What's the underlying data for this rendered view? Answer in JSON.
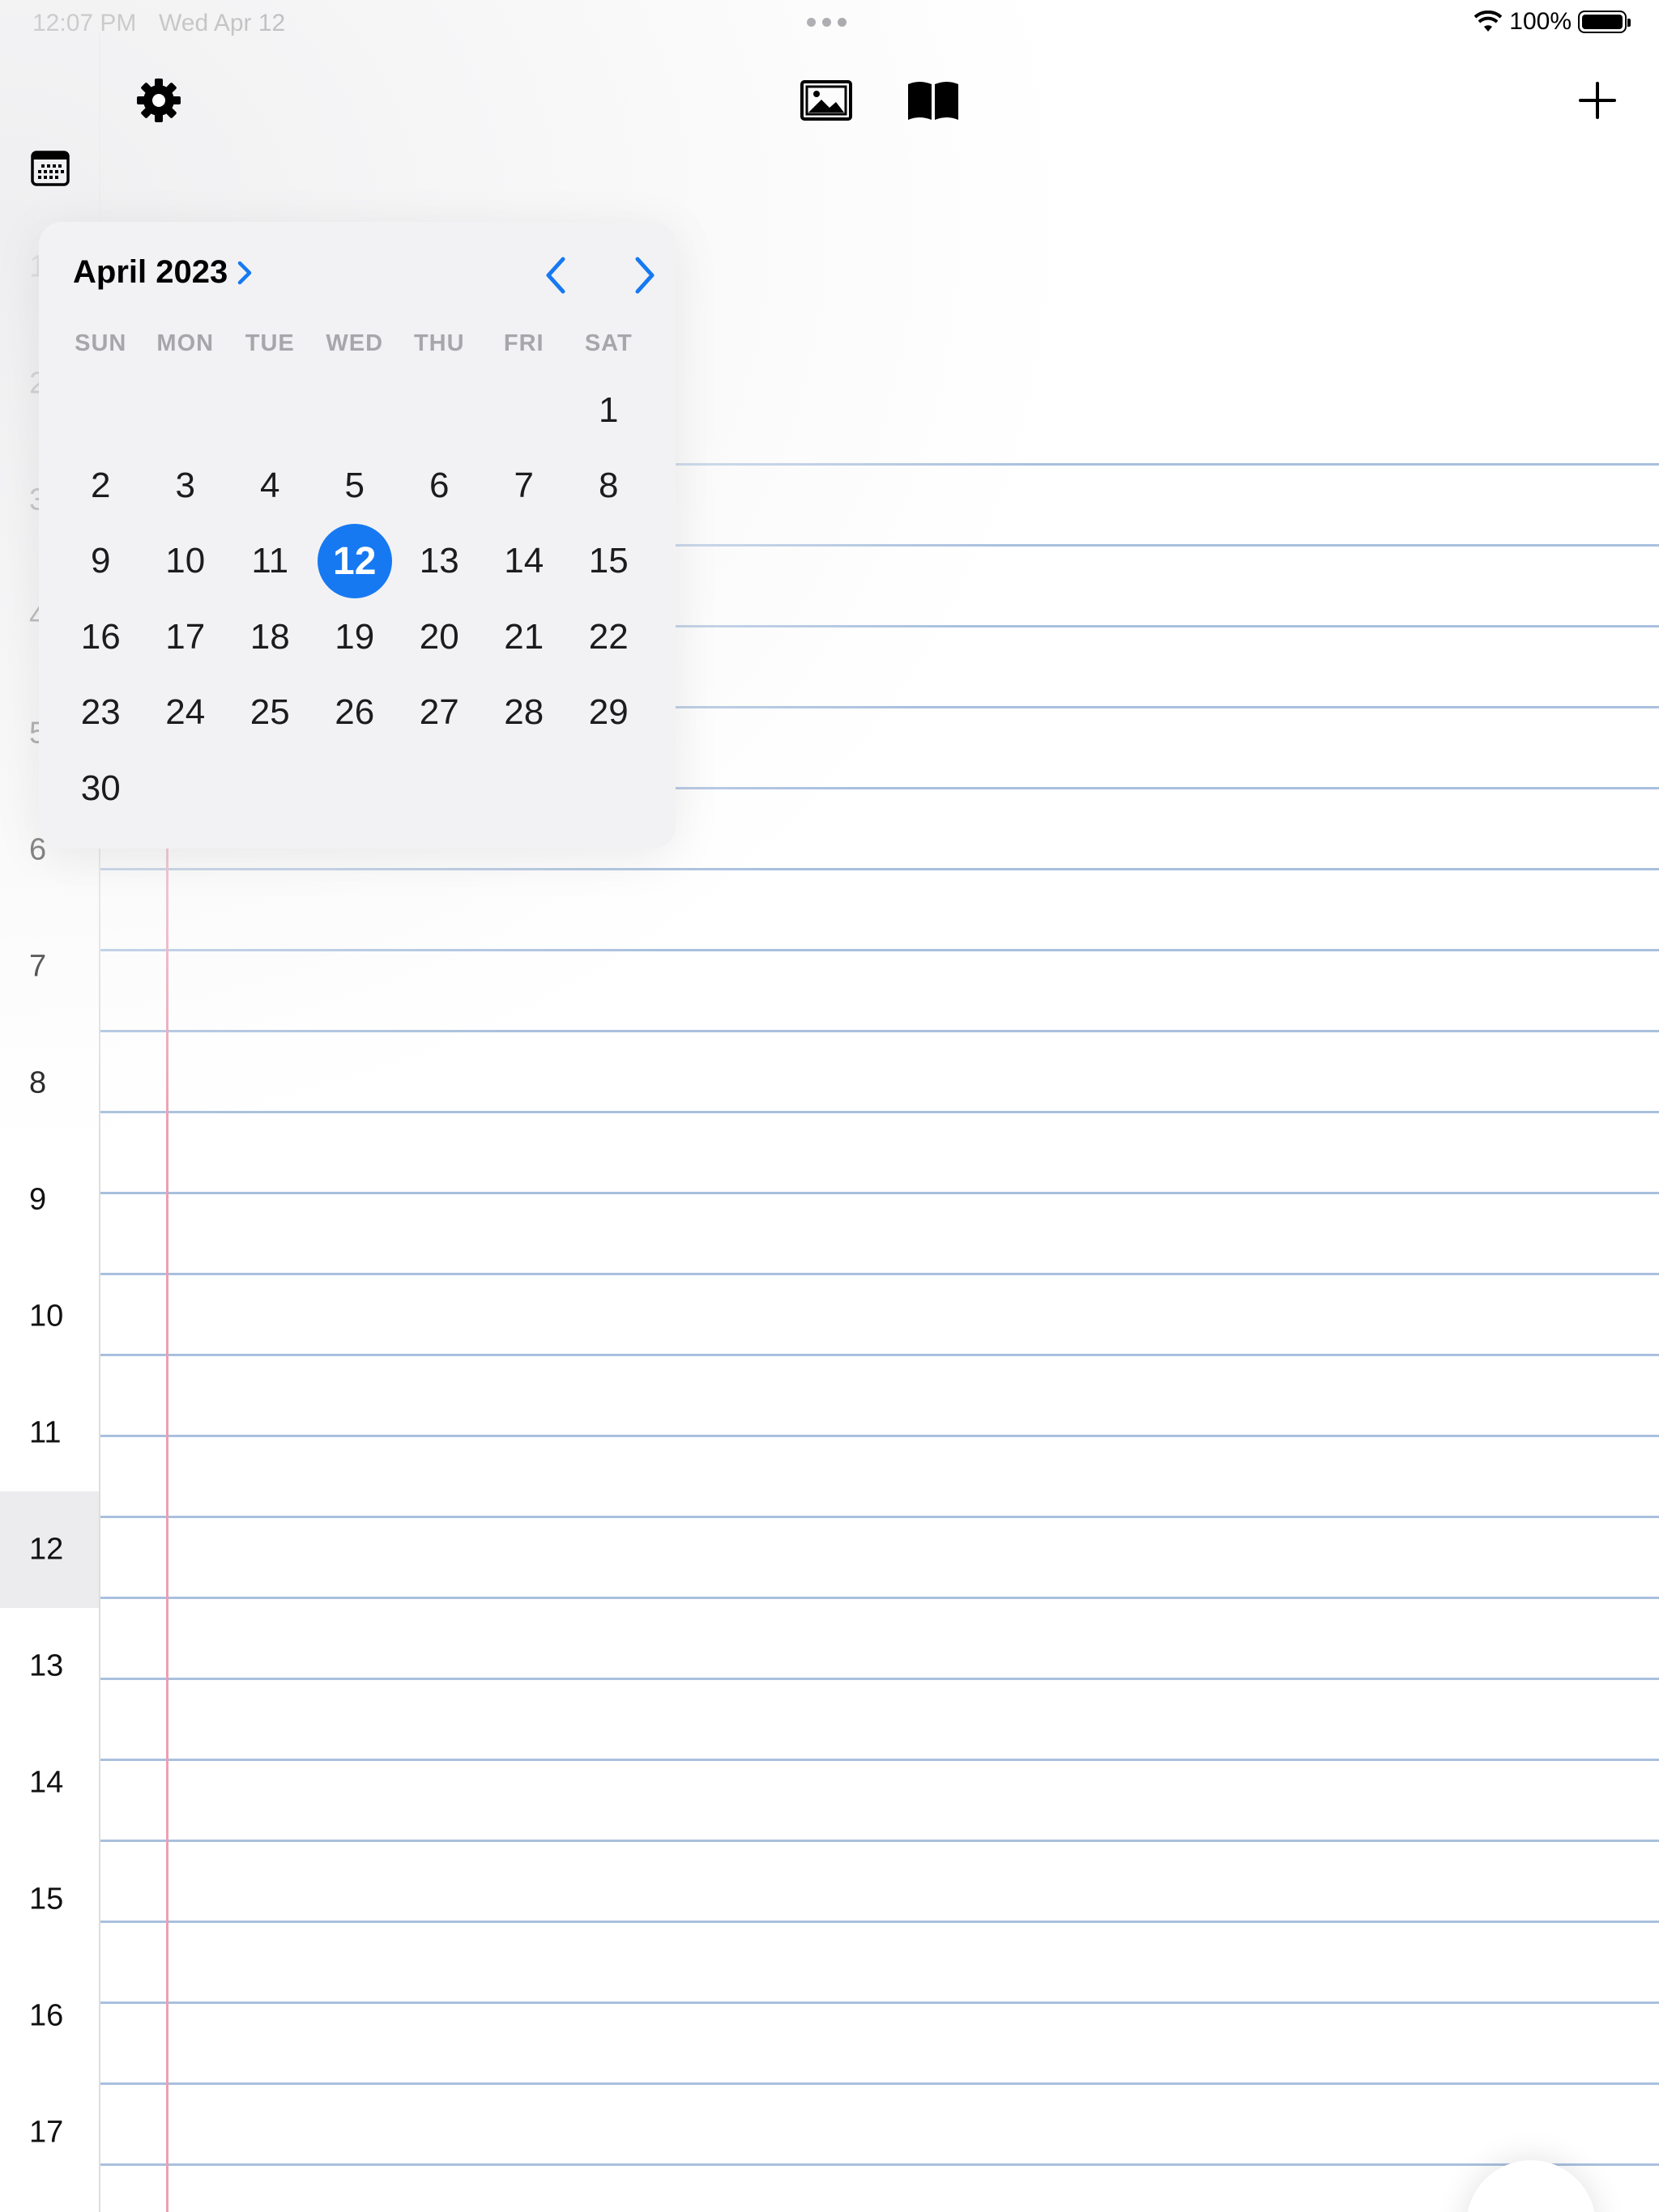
{
  "status_bar": {
    "time": "12:07 PM",
    "date": "Wed Apr 12",
    "battery": "100%",
    "battery_level": 1.0
  },
  "toolbar": {
    "settings_icon": "gear-icon",
    "photo_icon": "photo-icon",
    "book_icon": "book-icon",
    "add_icon": "plus-icon",
    "calendar_icon": "calendar-icon"
  },
  "hours": [
    {
      "label": "1"
    },
    {
      "label": "2"
    },
    {
      "label": "3"
    },
    {
      "label": "4"
    },
    {
      "label": "5"
    },
    {
      "label": "6"
    },
    {
      "label": "7"
    },
    {
      "label": "8"
    },
    {
      "label": "9"
    },
    {
      "label": "10"
    },
    {
      "label": "11"
    },
    {
      "label": "12"
    },
    {
      "label": "13"
    },
    {
      "label": "14"
    },
    {
      "label": "15"
    },
    {
      "label": "16"
    },
    {
      "label": "17"
    }
  ],
  "current_hour": "12",
  "calendar": {
    "month_label": "April 2023",
    "weekdays": [
      "SUN",
      "MON",
      "TUE",
      "WED",
      "THU",
      "FRI",
      "SAT"
    ],
    "first_weekday_index": 6,
    "days": [
      "1",
      "2",
      "3",
      "4",
      "5",
      "6",
      "7",
      "8",
      "9",
      "10",
      "11",
      "12",
      "13",
      "14",
      "15",
      "16",
      "17",
      "18",
      "19",
      "20",
      "21",
      "22",
      "23",
      "24",
      "25",
      "26",
      "27",
      "28",
      "29",
      "30"
    ],
    "selected_day": "12"
  },
  "colors": {
    "accent": "#1779f2",
    "rule_line": "#a9c0de",
    "margin_line": "#eaa0b4",
    "popover_bg": "#f2f2f4",
    "weekday_text": "#a7a7ab"
  }
}
